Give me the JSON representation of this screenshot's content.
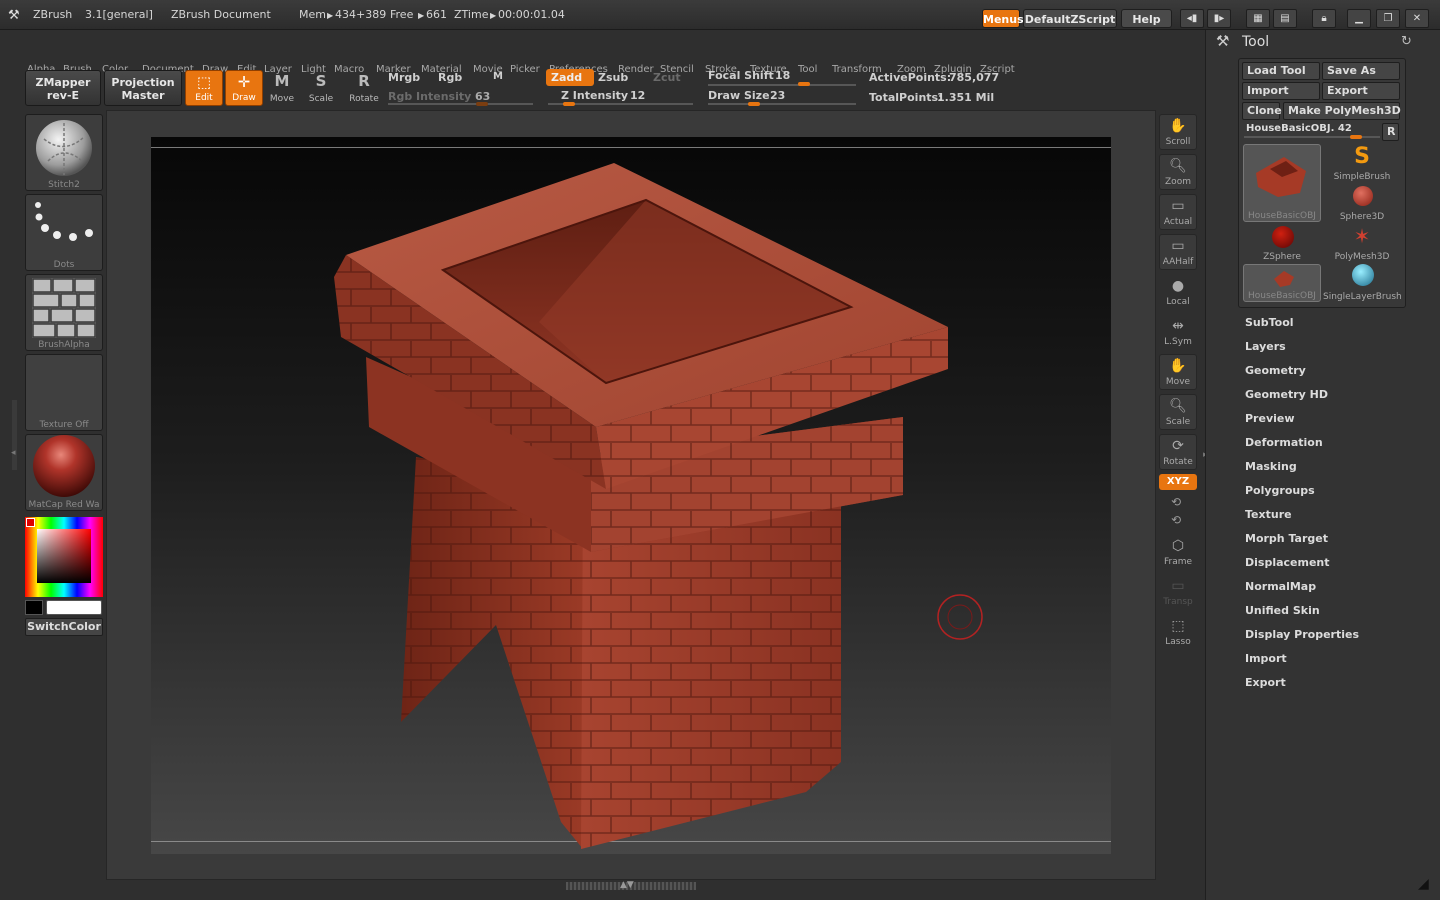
{
  "titlebar": {
    "app": "ZBrush",
    "version": "3.1[general]",
    "document": "ZBrush Document",
    "mem_label": "Mem",
    "mem_value": "434+389",
    "free_label": "Free",
    "free_value": "661",
    "ztime_label": "ZTime",
    "ztime_value": "00:00:01.04",
    "menus_button": "Menus",
    "script_button": "DefaultZScript",
    "help_button": "Help"
  },
  "menubar": [
    "Alpha",
    "Brush",
    "Color",
    "Document",
    "Draw",
    "Edit",
    "Layer",
    "Light",
    "Macro",
    "Marker",
    "Material",
    "Movie",
    "Picker",
    "Preferences",
    "Render",
    "Stencil",
    "Stroke",
    "Texture",
    "Tool",
    "Transform",
    "Zoom",
    "Zplugin",
    "Zscript"
  ],
  "toolbar": {
    "zmapper_line1": "ZMapper",
    "zmapper_line2": "rev-E",
    "projection_line1": "Projection",
    "projection_line2": "Master",
    "edit": "Edit",
    "draw": "Draw",
    "move": "Move",
    "scale": "Scale",
    "rotate": "Rotate",
    "mrgb": "Mrgb",
    "rgb": "Rgb",
    "m": "M",
    "rgb_intensity_label": "Rgb Intensity",
    "rgb_intensity_value": "63",
    "zadd": "Zadd",
    "zsub": "Zsub",
    "zcut": "Zcut",
    "z_intensity_label": "Z Intensity",
    "z_intensity_value": "12",
    "focal_shift_label": "Focal Shift",
    "focal_shift_value": "18",
    "draw_size_label": "Draw Size",
    "draw_size_value": "23",
    "active_points_label": "ActivePoints:",
    "active_points_value": "785,077",
    "total_points_label": "TotalPoints:",
    "total_points_value": "1.351 Mil"
  },
  "leftpanel": {
    "brush": "Stitch2",
    "stroke": "Dots",
    "alpha": "BrushAlpha",
    "texture": "Texture Off",
    "material": "MatCap Red Wa",
    "switch_color": "SwitchColor",
    "material_color": "#a3261c"
  },
  "rightstrip": [
    "Scroll",
    "Zoom",
    "Actual",
    "AAHalf",
    "Local",
    "L.Sym",
    "Move",
    "Scale",
    "Rotate",
    "XYZ",
    "Frame",
    "Transp",
    "Lasso"
  ],
  "toolpanel": {
    "title": "Tool",
    "load_tool": "Load Tool",
    "save_as": "Save As",
    "import": "Import",
    "export": "Export",
    "clone": "Clone",
    "make_polymesh": "Make PolyMesh3D",
    "current_tool": "HouseBasicOBJ. 42",
    "r_button": "R",
    "tools": [
      "HouseBasicOBJ",
      "SimpleBrush",
      "Sphere3D",
      "ZSphere",
      "PolyMesh3D",
      "HouseBasicOBJ",
      "SingleLayerBrush"
    ],
    "sections": [
      "SubTool",
      "Layers",
      "Geometry",
      "Geometry HD",
      "Preview",
      "Deformation",
      "Masking",
      "Polygroups",
      "Texture",
      "Morph Target",
      "Displacement",
      "NormalMap",
      "Unified Skin",
      "Display Properties",
      "Import",
      "Export"
    ]
  },
  "colors": {
    "accent": "#e87510",
    "model": "#9e3a26"
  }
}
